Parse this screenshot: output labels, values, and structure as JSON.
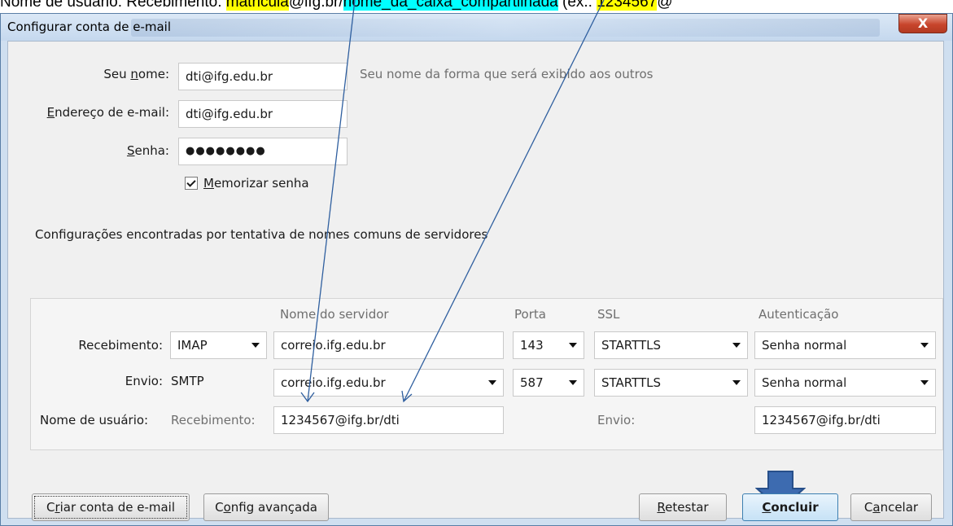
{
  "caption": {
    "prefix": "Nome de usuário: Recebimento: ",
    "hl1": "matricula",
    "mid": "@ifg.br/",
    "hl2": "nome_da_caixa_compartilhada",
    "suffix": " (ex.: ",
    "hl3": "1234567",
    "end": "@"
  },
  "window": {
    "title": "Configurar conta de e-mail",
    "close": "X"
  },
  "form": {
    "name_label": "Seu nome:",
    "name_value": "dti@ifg.edu.br",
    "name_hint": "Seu nome da forma que será exibido aos outros",
    "email_label": "Endereço de e-mail:",
    "email_value": "dti@ifg.edu.br",
    "password_label": "Senha:",
    "password_value": "●●●●●●●●",
    "remember_label": "Memorizar senha",
    "found_text": "Configurações encontradas por tentativa de nomes comuns de servidores"
  },
  "server": {
    "headers": {
      "server_name": "Nome do servidor",
      "port": "Porta",
      "ssl": "SSL",
      "auth": "Autenticação"
    },
    "incoming": {
      "label": "Recebimento:",
      "protocol": "IMAP",
      "hostname": "correio.ifg.edu.br",
      "port": "143",
      "ssl": "STARTTLS",
      "auth": "Senha normal"
    },
    "outgoing": {
      "label": "Envio:",
      "protocol": "SMTP",
      "hostname": "correio.ifg.edu.br",
      "port": "587",
      "ssl": "STARTTLS",
      "auth": "Senha normal"
    },
    "username": {
      "label": "Nome de usuário:",
      "incoming_label": "Recebimento:",
      "incoming_value": "1234567@ifg.br/dti",
      "outgoing_label": "Envio:",
      "outgoing_value": "1234567@ifg.br/dti"
    }
  },
  "buttons": {
    "create": "Criar conta de e-mail",
    "advanced": "Config avançada",
    "retest": "Retestar",
    "done": "Concluir",
    "cancel": "Cancelar"
  },
  "colors": {
    "arrow_blue": "#2f5f9f",
    "highlight_yellow": "#ffff00",
    "highlight_cyan": "#00ffff"
  }
}
